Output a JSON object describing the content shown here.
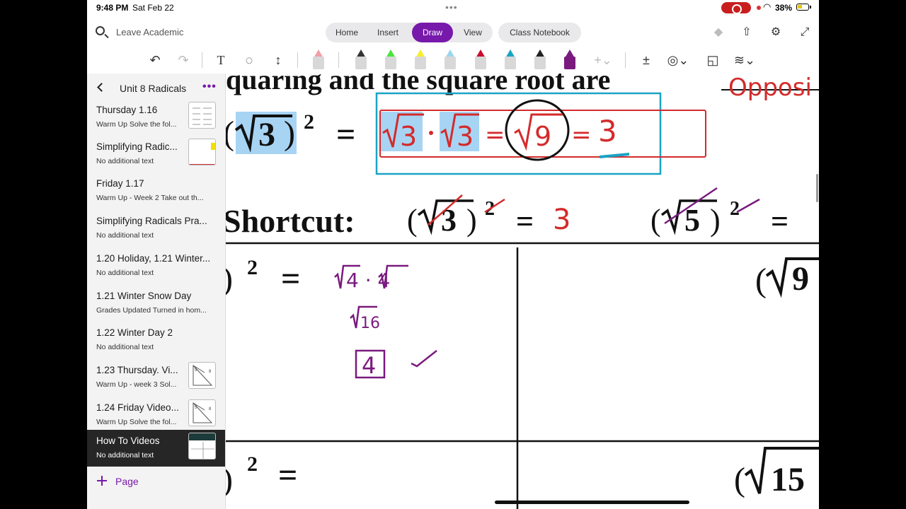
{
  "status": {
    "time": "9:48 PM",
    "date": "Sat Feb 22",
    "battery": "38%"
  },
  "topbar": {
    "search_text": "Leave Academic",
    "tabs": [
      {
        "label": "Home",
        "active": false
      },
      {
        "label": "Insert",
        "active": false
      },
      {
        "label": "Draw",
        "active": true
      },
      {
        "label": "View",
        "active": false
      }
    ],
    "class_notebook": "Class Notebook"
  },
  "sidebar": {
    "section_title": "Unit 8 Radicals",
    "pages": [
      {
        "title": "Thursday 1.16",
        "subtitle": "Warm Up  Solve the fol...",
        "thumb": true
      },
      {
        "title": "Simplifying Radic...",
        "subtitle": "No additional text",
        "thumb": true
      },
      {
        "title": "Friday 1.17",
        "subtitle": "Warm Up - Week 2  Take out th...",
        "thumb": false
      },
      {
        "title": "Simplifying Radicals Pra...",
        "subtitle": "No additional text",
        "thumb": false
      },
      {
        "title": "1.20 Holiday, 1.21 Winter...",
        "subtitle": "No additional text",
        "thumb": false
      },
      {
        "title": "1.21 Winter Snow Day",
        "subtitle": "Grades Updated  Turned in hom...",
        "thumb": false
      },
      {
        "title": "1.22 Winter Day 2",
        "subtitle": "No additional text",
        "thumb": false
      },
      {
        "title": "1.23 Thursday. Vi...",
        "subtitle": "Warm Up - week 3  Sol...",
        "thumb": true
      },
      {
        "title": "1.24 Friday Video...",
        "subtitle": "Warm Up  Solve the fol...",
        "thumb": true
      },
      {
        "title": "How To Videos",
        "subtitle": "No additional text",
        "thumb": true,
        "active": true
      }
    ],
    "add_page_label": "Page"
  },
  "canvas": {
    "heading": "quaring and the square root are",
    "heading_ink": "Opposi",
    "eq_radicand": "3",
    "eq_exponent": "2",
    "ink_sqrt3_a": "3",
    "ink_sqrt3_b": "3",
    "ink_sqrt9": "9",
    "ink_result": "3",
    "shortcut_label": "Shortcut:",
    "shortcut_a_radicand": "3",
    "shortcut_a_exponent": "2",
    "shortcut_a_ink": "3",
    "shortcut_b_radicand": "5",
    "shortcut_b_exponent": "2",
    "work_expr": "4 · 4",
    "work_step": "16",
    "work_answer": "4",
    "cell_tr_radicand": "9",
    "cell_bl_exponent": "2",
    "cell_br_radicand": "15"
  },
  "colors": {
    "accent": "#7719aa",
    "ink_red": "#d42a2a",
    "ink_purple": "#7a1a7e",
    "box_blue": "#1aa3c4",
    "highlight": "#a8d4f4"
  }
}
